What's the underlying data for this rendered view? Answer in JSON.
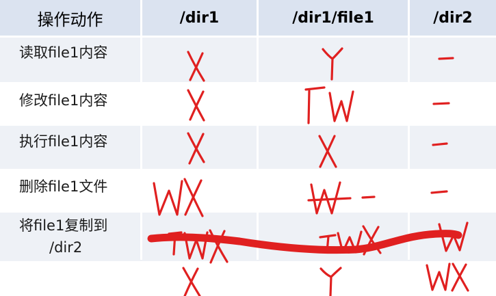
{
  "table": {
    "headers": [
      "操作动作",
      "/dir1",
      "/dir1/file1",
      "/dir2"
    ],
    "rows": [
      {
        "action": "读取file1内容",
        "marks": [
          "X",
          "Y",
          "—"
        ]
      },
      {
        "action": "修改file1内容",
        "marks": [
          "X",
          "JW",
          "—"
        ]
      },
      {
        "action": "执行file1内容",
        "marks": [
          "X",
          "X",
          "—"
        ]
      },
      {
        "action": "删除file1文件",
        "marks": [
          "WX",
          "W —",
          "—"
        ]
      },
      {
        "action": "将file1复制到\n/dir2",
        "action_line1": "将file1复制到",
        "action_line2": "/dir2",
        "marks": [
          "WX",
          "JWX",
          "W"
        ]
      },
      {
        "action": "",
        "marks": [
          "X",
          "Y",
          "WX"
        ]
      }
    ]
  },
  "colors": {
    "header_bg": "#dbe3f0",
    "row_alt_bg": "#eef1f6",
    "ink": "#e02020"
  }
}
